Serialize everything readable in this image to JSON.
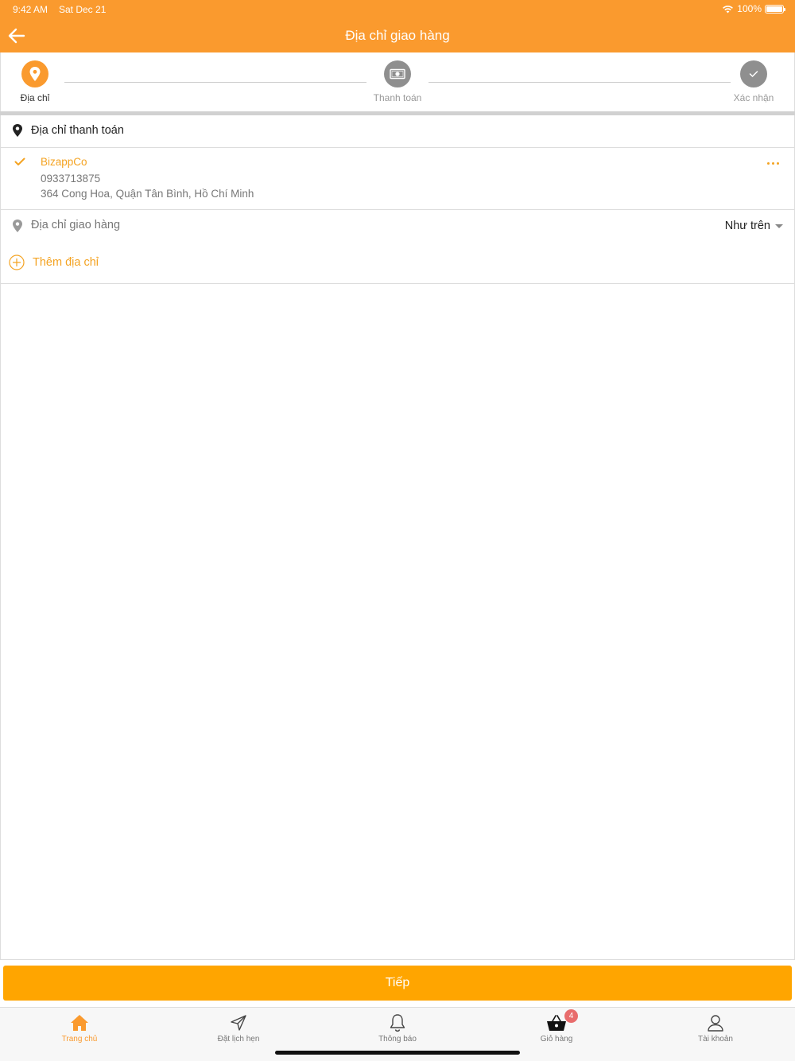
{
  "status_bar": {
    "time": "9:42 AM",
    "date": "Sat Dec 21",
    "battery": "100%"
  },
  "header": {
    "title": "Địa chỉ giao hàng"
  },
  "stepper": {
    "steps": [
      {
        "label": "Địa chỉ",
        "icon": "location-pin-icon",
        "state": "active"
      },
      {
        "label": "Thanh toán",
        "icon": "cash-icon",
        "state": "inactive"
      },
      {
        "label": "Xác nhận",
        "icon": "check-icon",
        "state": "inactive"
      }
    ]
  },
  "billing": {
    "section_title": "Địa chỉ thanh toán",
    "address": {
      "name": "BizappCo",
      "phone": "0933713875",
      "line": "364 Cong Hoa, Quận Tân Bình, Hồ Chí Minh",
      "selected": true
    }
  },
  "shipping": {
    "label": "Địa chỉ giao hàng",
    "selected_option": "Như trên",
    "add_address_label": "Thêm địa chỉ"
  },
  "next_button": {
    "label": "Tiếp"
  },
  "tabbar": {
    "tabs": [
      {
        "label": "Trang chủ",
        "icon": "home-icon",
        "active": true
      },
      {
        "label": "Đặt lịch hẹn",
        "icon": "send-icon",
        "active": false
      },
      {
        "label": "Thông báo",
        "icon": "bell-icon",
        "active": false
      },
      {
        "label": "Giỏ hàng",
        "icon": "basket-icon",
        "active": false,
        "badge": "4"
      },
      {
        "label": "Tài khoản",
        "icon": "user-icon",
        "active": false
      }
    ]
  },
  "colors": {
    "primary": "#FA9A2E",
    "accent": "#F4A322",
    "button": "#FFA500",
    "badge": "#E86C6C"
  }
}
